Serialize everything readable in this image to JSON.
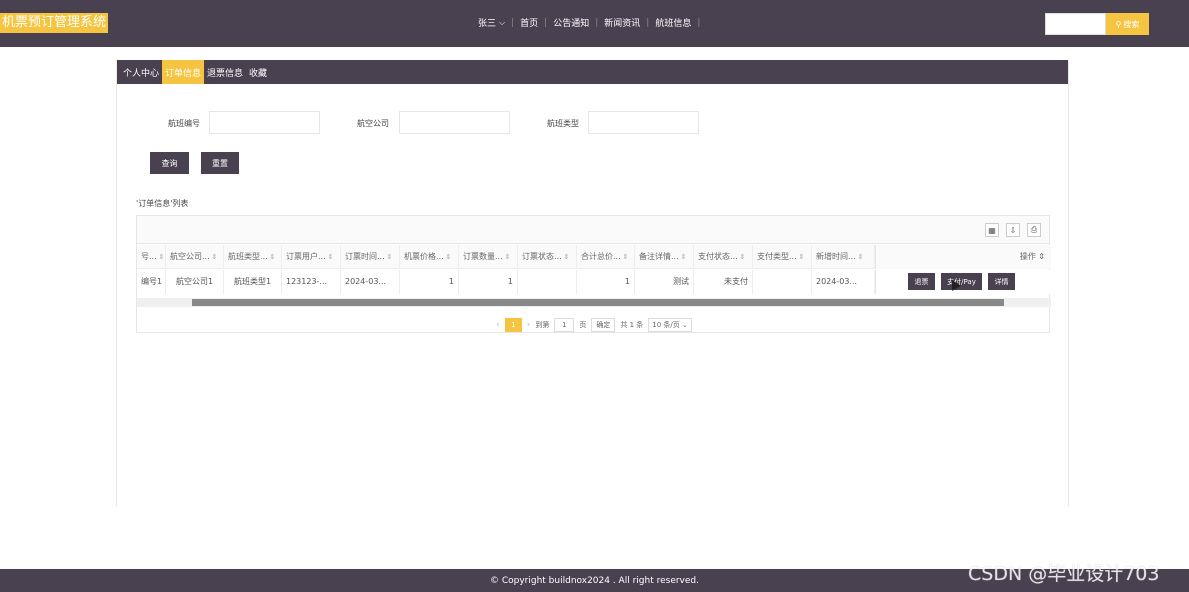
{
  "brand": "机票预订管理系统",
  "nav": {
    "user": "张三",
    "items": [
      "首页",
      "公告通知",
      "新闻资讯",
      "航班信息"
    ]
  },
  "search": {
    "button": "搜索",
    "placeholder": ""
  },
  "tabs": [
    "个人中心",
    "订单信息",
    "退票信息",
    "收藏"
  ],
  "active_tab": 1,
  "filters": [
    {
      "label": "航班编号",
      "value": ""
    },
    {
      "label": "航空公司",
      "value": ""
    },
    {
      "label": "航班类型",
      "value": ""
    }
  ],
  "buttons": {
    "query": "查询",
    "reset": "重置"
  },
  "list_title": "'订单信息'列表",
  "table": {
    "columns": [
      "号...",
      "航空公司...",
      "航班类型...",
      "订票用户...",
      "订票时间...",
      "机票价格...",
      "订票数量...",
      "订票状态...",
      "合计总价...",
      "备注详情...",
      "支付状态...",
      "支付类型...",
      "新增时间..."
    ],
    "ops_header": "操作",
    "rows": [
      {
        "cells": [
          "编号1",
          "航空公司1",
          "航班类型1",
          "123123-...",
          "2024-03...",
          "1",
          "1",
          "",
          "1",
          "测试",
          "未支付",
          "",
          "2024-03..."
        ],
        "actions": [
          "退票",
          "支付/Pay",
          "详情"
        ]
      }
    ]
  },
  "pager": {
    "current": "1",
    "goto_label": "到第",
    "goto_value": "1",
    "page_unit": "页",
    "confirm": "确定",
    "total": "共 1 条",
    "page_size": "10 条/页"
  },
  "footer": "© Copyright buildnox2024 . All right reserved.",
  "watermark": "CSDN @毕业设计703",
  "colors": {
    "dark": "#4a4150",
    "accent": "#f5c542"
  }
}
